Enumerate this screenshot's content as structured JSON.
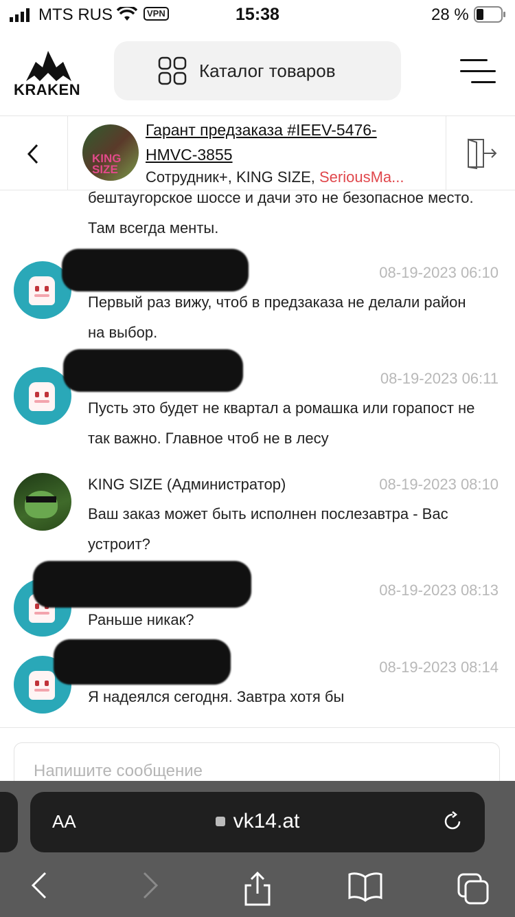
{
  "status_bar": {
    "carrier": "MTS RUS",
    "vpn": "VPN",
    "time": "15:38",
    "battery": "28 %"
  },
  "header": {
    "logo_text": "KRAKEN",
    "catalog_label": "Каталог товаров"
  },
  "chat": {
    "title": "Гарант предзаказа #IEEV-5476-HMVC-3855",
    "members_prefix": "Сотрудник+, KING SIZE, ",
    "members_highlight": "SeriousMa...",
    "avatar_text": "KING SIZE",
    "colors": {
      "highlight": "#e0474c"
    }
  },
  "messages": [
    {
      "name": "",
      "time": "",
      "text": "бештаугорское шоссе и дачи это не безопасное место. Там всегда менты."
    },
    {
      "name": "",
      "time": "08-19-2023 06:10",
      "text": "Первый раз вижу, чтоб в предзаказа не делали район на выбор."
    },
    {
      "name": "",
      "time": "08-19-2023 06:11",
      "text": "Пусть это будет не квартал а ромашка или горапост не так важно. Главное чтоб не в лесу"
    },
    {
      "name": "KING SIZE (Администратор)",
      "time": "08-19-2023 08:10",
      "text": "Ваш заказ может быть исполнен послезавтра - Вас устроит?"
    },
    {
      "name": "",
      "time": "08-19-2023 08:13",
      "text": "Раньше никак?"
    },
    {
      "name": "",
      "time": "08-19-2023 08:14",
      "text": "Я надеялся сегодня. Завтра хотя бы"
    }
  ],
  "composer": {
    "placeholder": "Напишите сообщение"
  },
  "browser": {
    "aa_label": "AA",
    "url": "vk14.at"
  }
}
